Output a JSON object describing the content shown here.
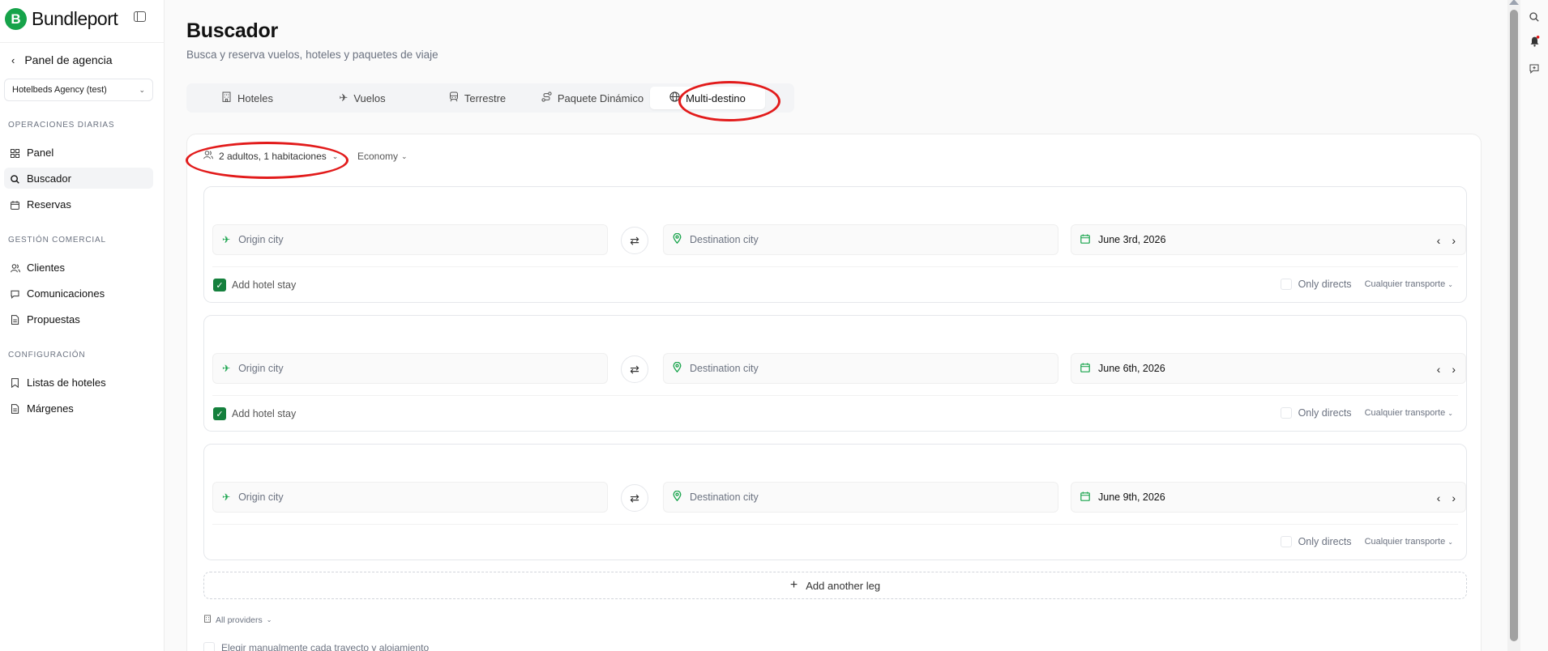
{
  "brand": {
    "logo_letter": "B",
    "name": "Bundleport"
  },
  "sidebar": {
    "back_label": "Panel de agencia",
    "agency_select_value": "Hotelbeds Agency (test)",
    "sections": [
      {
        "label": "OPERACIONES DIARIAS",
        "items": [
          {
            "label": "Panel",
            "icon": "dashboard-icon"
          },
          {
            "label": "Buscador",
            "icon": "search-icon",
            "active": true
          },
          {
            "label": "Reservas",
            "icon": "calendar-icon"
          }
        ]
      },
      {
        "label": "GESTIÓN COMERCIAL",
        "items": [
          {
            "label": "Clientes",
            "icon": "users-icon"
          },
          {
            "label": "Comunicaciones",
            "icon": "chat-icon"
          },
          {
            "label": "Propuestas",
            "icon": "document-icon"
          }
        ]
      },
      {
        "label": "CONFIGURACIÓN",
        "items": [
          {
            "label": "Listas de hoteles",
            "icon": "bookmark-icon"
          },
          {
            "label": "Márgenes",
            "icon": "document-icon"
          }
        ]
      }
    ]
  },
  "page": {
    "title": "Buscador",
    "subtitle": "Busca y reserva vuelos, hoteles y paquetes de viaje"
  },
  "tabs": [
    {
      "label": "Hoteles",
      "icon": "hotel-icon"
    },
    {
      "label": "Vuelos",
      "icon": "plane-icon"
    },
    {
      "label": "Terrestre",
      "icon": "train-icon"
    },
    {
      "label": "Paquete Dinámico",
      "icon": "route-icon"
    },
    {
      "label": "Multi-destino",
      "icon": "globe-icon",
      "active": true
    }
  ],
  "search": {
    "pax_label": "2 adultos, 1 habitaciones",
    "class_label": "Economy",
    "legs": [
      {
        "origin_placeholder": "Origin city",
        "destination_placeholder": "Destination city",
        "date": "June 3rd, 2026",
        "hotel_label": "Add hotel stay",
        "hotel_checked": true,
        "directs_label": "Only directs",
        "transport_label": "Cualquier transporte"
      },
      {
        "origin_placeholder": "Origin city",
        "destination_placeholder": "Destination city",
        "date": "June 6th, 2026",
        "hotel_label": "Add hotel stay",
        "hotel_checked": true,
        "directs_label": "Only directs",
        "transport_label": "Cualquier transporte"
      },
      {
        "origin_placeholder": "Origin city",
        "destination_placeholder": "Destination city",
        "date": "June 9th, 2026",
        "hotel_label": null,
        "hotel_checked": false,
        "directs_label": "Only directs",
        "transport_label": "Cualquier transporte"
      }
    ],
    "add_leg_label": "Add another leg",
    "providers_label": "All providers",
    "manual_choose_label": "Elegir manualmente cada trayecto y alojamiento"
  },
  "colors": {
    "brand_green": "#16a34a",
    "checkbox_green": "#15803d",
    "annotation_red": "#e21b1b"
  }
}
